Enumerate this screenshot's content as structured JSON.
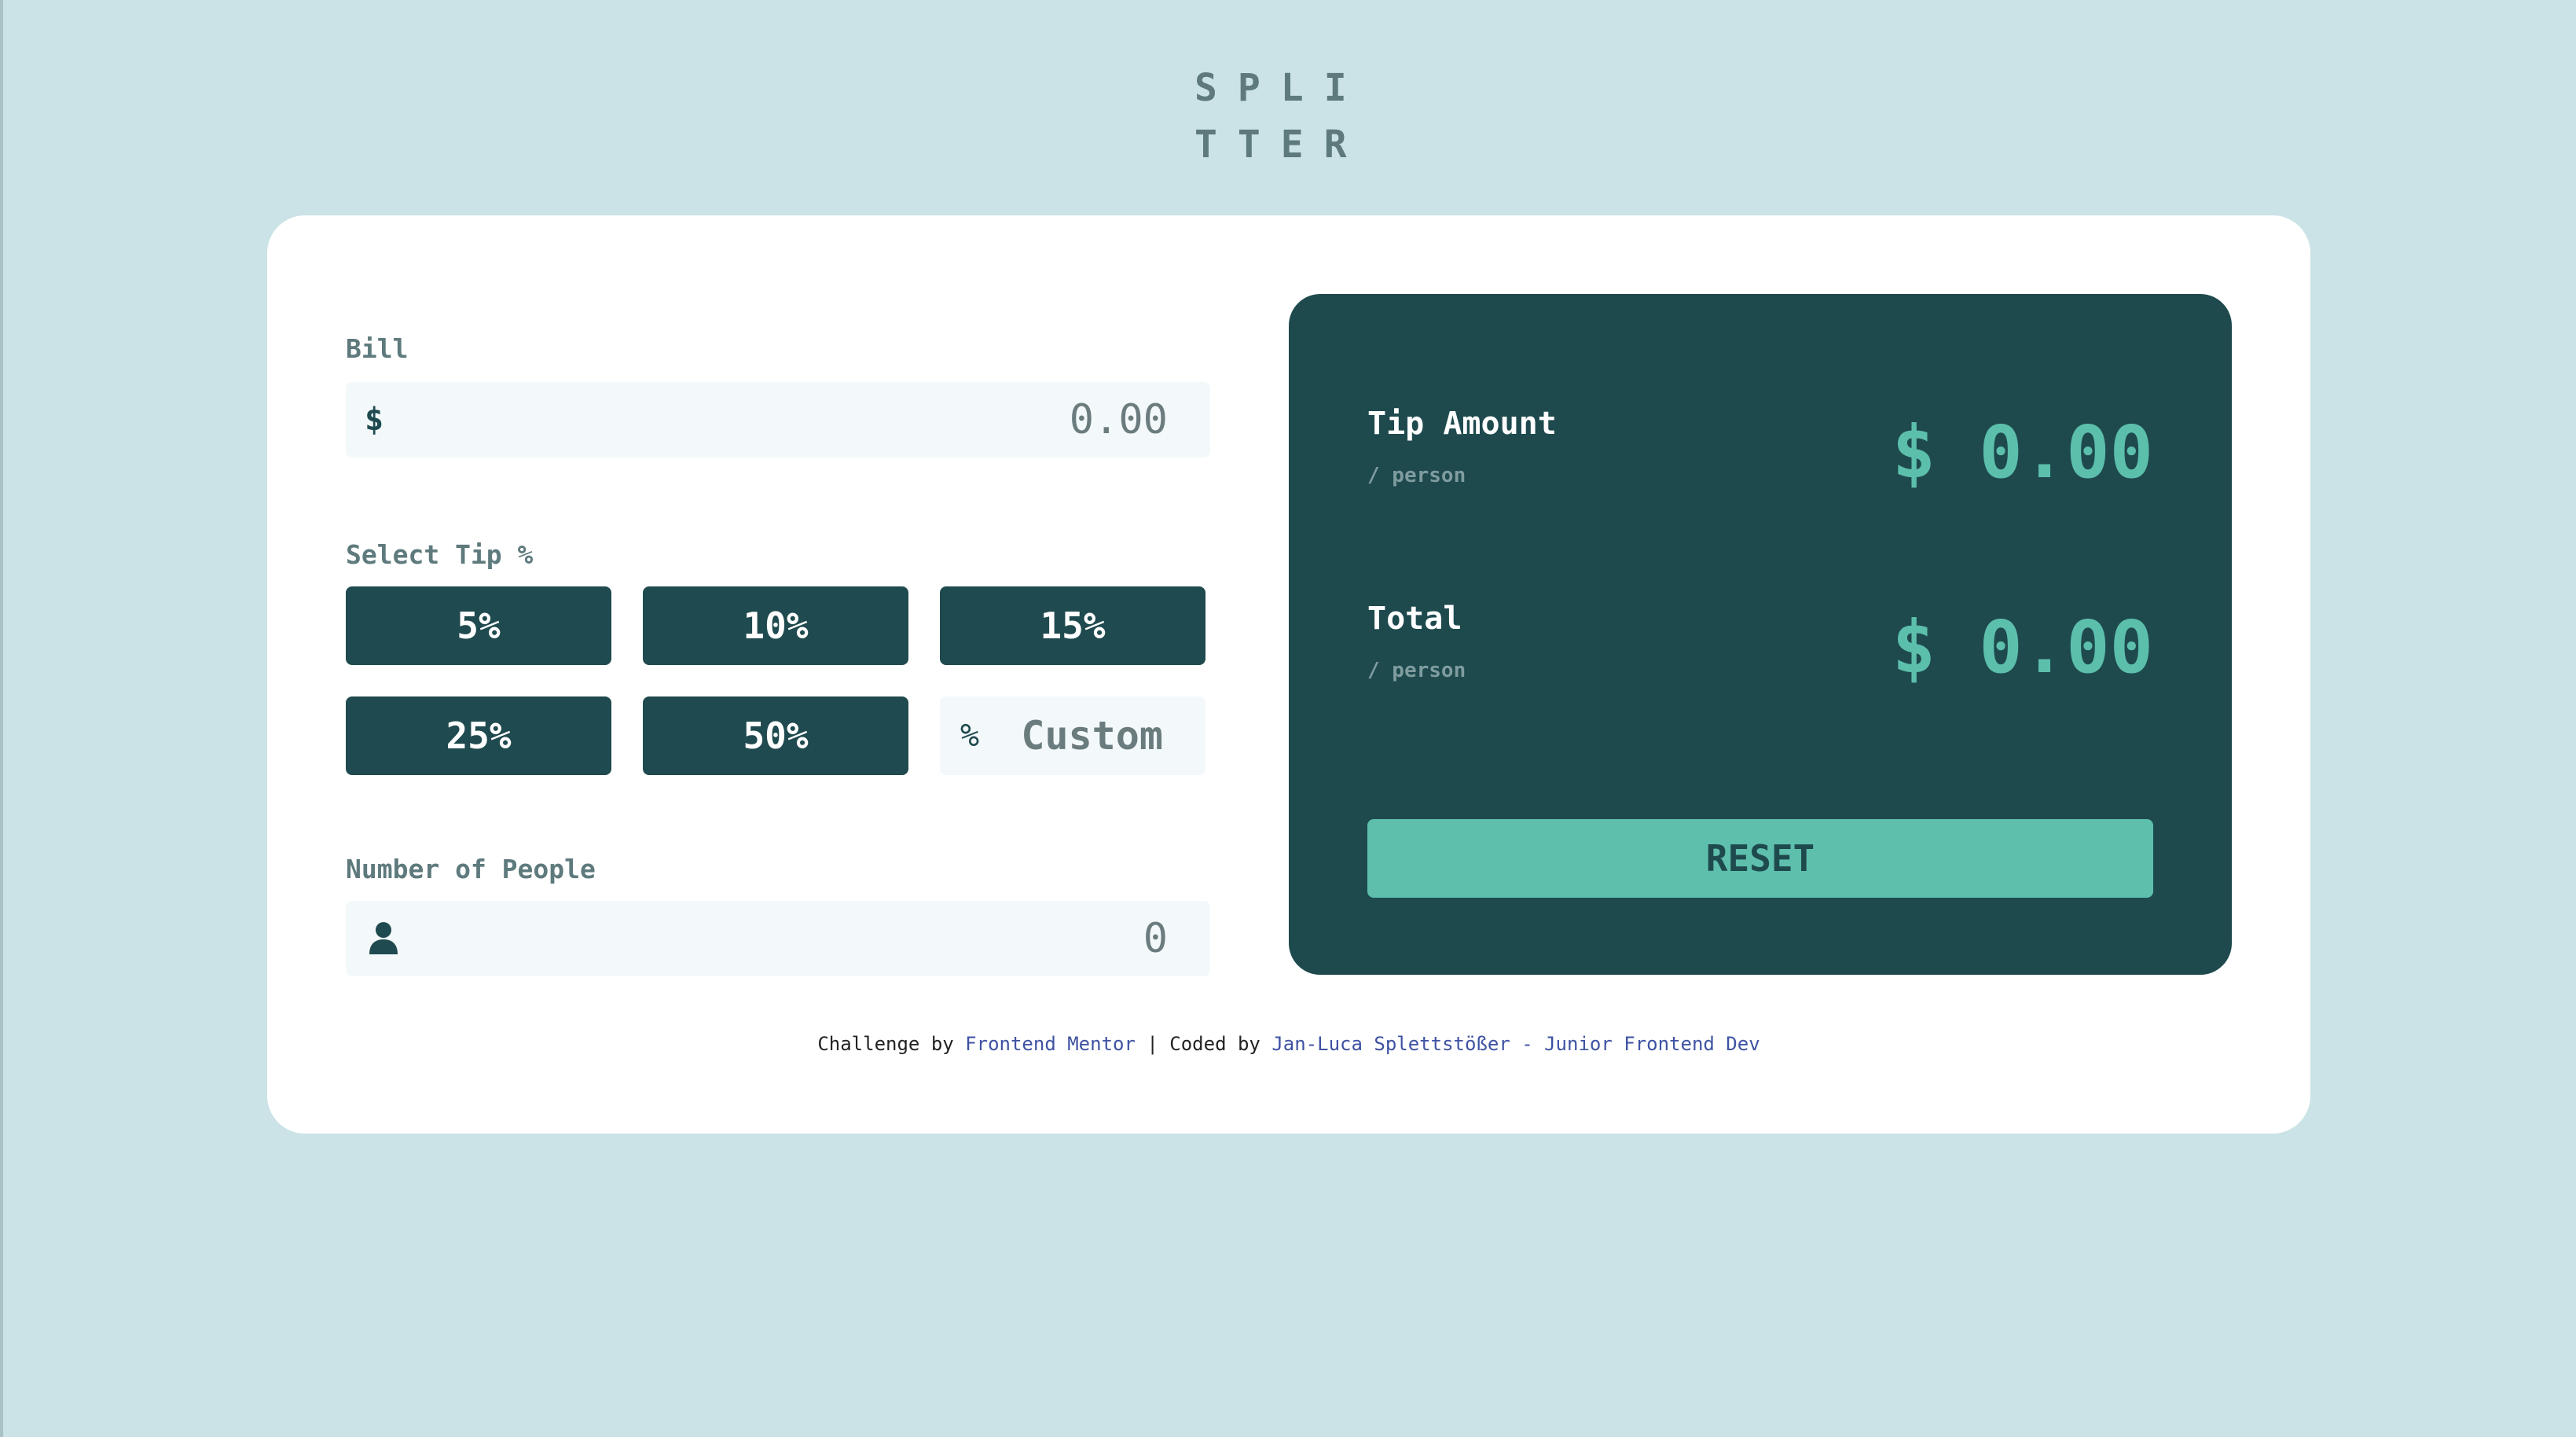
{
  "logo": {
    "line1": "SPLI",
    "line2": "TTER"
  },
  "bill": {
    "label": "Bill",
    "currency_symbol": "$",
    "placeholder": "0.00"
  },
  "tip": {
    "label": "Select Tip %",
    "options": [
      "5%",
      "10%",
      "15%",
      "25%",
      "50%"
    ],
    "custom_symbol": "%",
    "custom_placeholder": "Custom"
  },
  "people": {
    "label": "Number of People",
    "icon": "person-icon",
    "placeholder": "0"
  },
  "results": {
    "tip_amount": {
      "title": "Tip Amount",
      "sub": "/ person",
      "value": "$ 0.00"
    },
    "total": {
      "title": "Total",
      "sub": "/ person",
      "value": "$ 0.00"
    },
    "reset_label": "RESET"
  },
  "footer": {
    "prefix": "Challenge by",
    "challenge_link": "Frontend Mentor",
    "separator": "| Coded by",
    "author_link": "Jan-Luca Splettstößer - Junior Frontend Dev"
  },
  "colors": {
    "background": "#cbe3e6",
    "dark_teal": "#1e4a4e",
    "accent": "#5dbfac",
    "label_gray": "#5e7a7d",
    "link_blue": "#3e52a3"
  }
}
